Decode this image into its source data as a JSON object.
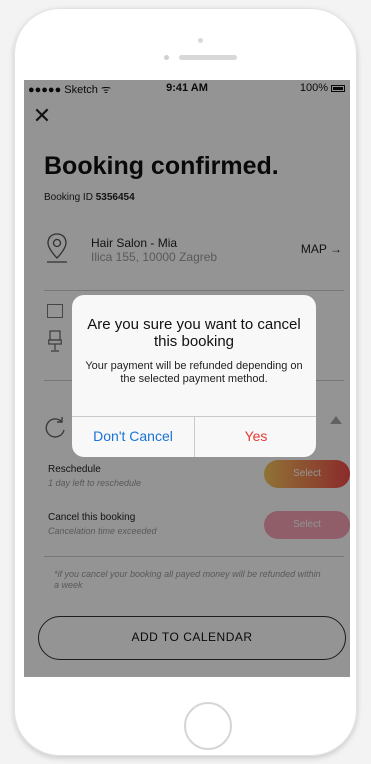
{
  "status_bar": {
    "carrier": "●●●●● Sketch ᯤ",
    "time": "9:41 AM",
    "battery": "100%"
  },
  "header": {
    "close_icon": "close-icon",
    "title": "Booking confirmed.",
    "booking_id_label": "Booking ID",
    "booking_id": "5356454"
  },
  "venue": {
    "name": "Hair Salon - Mia",
    "address": "Ilica 155, 10000 Zagreb",
    "map_link": "MAP →",
    "icon": "map-pin-icon"
  },
  "details": {
    "icons": [
      "calendar-icon",
      "seat-icon"
    ]
  },
  "actions": {
    "reschedule": {
      "title": "Reschedule",
      "subtitle": "1 day left to reschedule",
      "button": "Select"
    },
    "cancel": {
      "title": "Cancel this booking",
      "subtitle": "Cancelation time exceeded",
      "button": "Select"
    }
  },
  "note": "*if you cancel your booking all payed money will be refunded within a week",
  "calendar_button": "ADD TO CALENDAR",
  "dialog": {
    "title": "Are you sure you want to cancel this booking",
    "message": "Your payment will be refunded depending on the selected payment method.",
    "cancel_label": "Don't Cancel",
    "confirm_label": "Yes"
  },
  "colors": {
    "accent_blue": "#1a73d9",
    "destructive_red": "#e53935",
    "gradient_start": "#f6c65c",
    "gradient_end": "#ef4b4b"
  }
}
